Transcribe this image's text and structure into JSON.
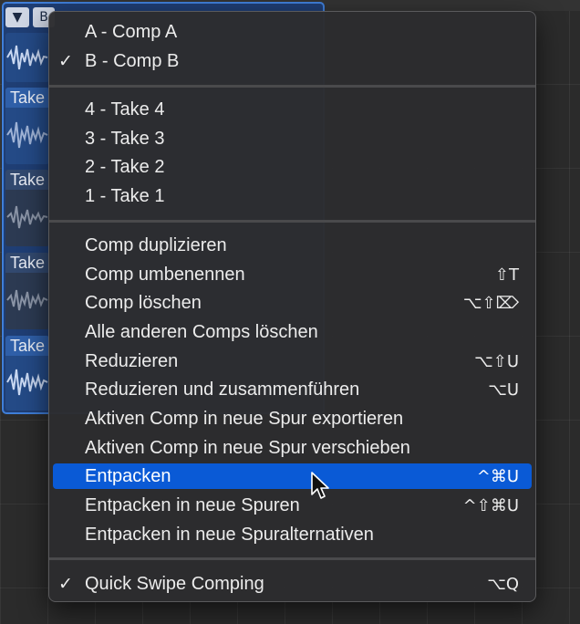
{
  "header": {
    "disclosure_glyph": "▼",
    "comp_letter": "B"
  },
  "lanes": [
    {
      "label": "Take"
    },
    {
      "label": "Take"
    },
    {
      "label": "Take"
    },
    {
      "label": "Take"
    }
  ],
  "menu": {
    "comps": [
      {
        "label": "A - Comp A",
        "checked": false,
        "check": ""
      },
      {
        "label": "B - Comp B",
        "checked": true,
        "check": "✓"
      }
    ],
    "takes": [
      {
        "label": "4 - Take 4"
      },
      {
        "label": "3 - Take 3"
      },
      {
        "label": "2 - Take 2"
      },
      {
        "label": "1 - Take 1"
      }
    ],
    "actions": [
      {
        "label": "Comp duplizieren",
        "shortcut": ""
      },
      {
        "label": "Comp umbenennen",
        "shortcut": "⇧T"
      },
      {
        "label": "Comp löschen",
        "shortcut": "⌥⇧⌦"
      },
      {
        "label": "Alle anderen Comps löschen",
        "shortcut": ""
      },
      {
        "label": "Reduzieren",
        "shortcut": "⌥⇧U"
      },
      {
        "label": "Reduzieren und zusammenführen",
        "shortcut": "⌥U"
      },
      {
        "label": "Aktiven Comp in neue Spur exportieren",
        "shortcut": ""
      },
      {
        "label": "Aktiven Comp in neue Spur verschieben",
        "shortcut": ""
      },
      {
        "label": "Entpacken",
        "shortcut": "^⌘U",
        "highlighted": true
      },
      {
        "label": "Entpacken in neue Spuren",
        "shortcut": "^⇧⌘U"
      },
      {
        "label": "Entpacken in neue Spuralternativen",
        "shortcut": ""
      }
    ],
    "quick_swipe": {
      "label": "Quick Swipe Comping",
      "shortcut": "⌥Q",
      "check": "✓",
      "checked": true
    }
  },
  "colors": {
    "highlight": "#0a5ad6",
    "lane_blue": "#244a86"
  }
}
